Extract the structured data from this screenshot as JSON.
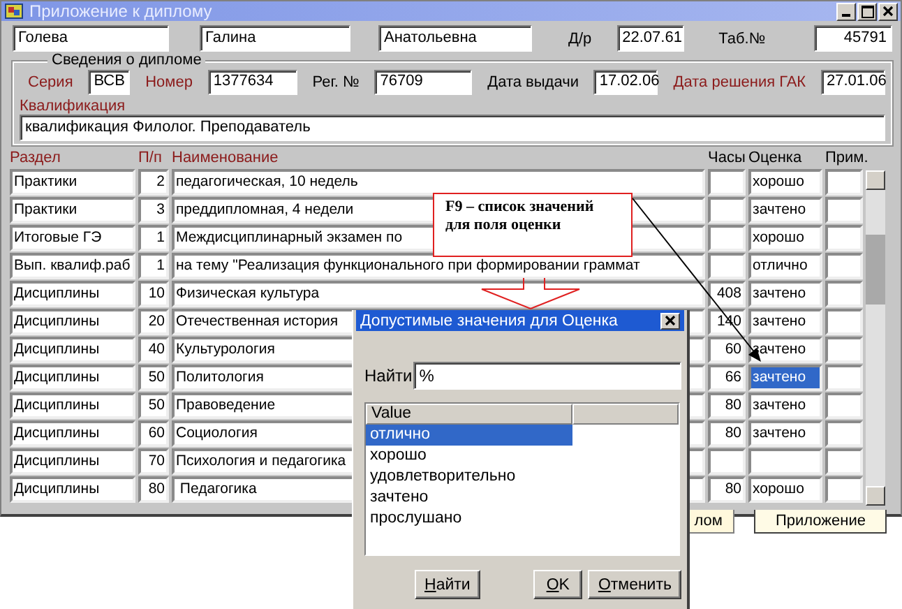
{
  "window": {
    "title": "Приложение к диплому"
  },
  "person": {
    "last_name": "Голева",
    "first_name": "Галина",
    "patronymic": "Анатольевна",
    "birth_label": "Д/р",
    "birth_date": "22.07.61",
    "tab_label": "Таб.№",
    "tab_number": "45791"
  },
  "diploma": {
    "title": "Сведения о дипломе",
    "fields": [
      {
        "label": "Серия",
        "value": "ВСВ",
        "required": true
      },
      {
        "label": "Номер",
        "value": "1377634",
        "required": true
      },
      {
        "label": "Рег. №",
        "value": "76709",
        "required": false
      },
      {
        "label": "Дата выдачи",
        "value": "17.02.06",
        "required": false
      },
      {
        "label": "Дата решения ГАК",
        "value": "27.01.06",
        "required": true
      }
    ],
    "qualification_label": "Квалификация",
    "qualification": "квалификация Филолог. Преподаватель"
  },
  "grid": {
    "columns": [
      {
        "label": "Раздел",
        "required": true
      },
      {
        "label": "П/п",
        "required": true
      },
      {
        "label": "Наименование",
        "required": true
      },
      {
        "label": "Часы",
        "required": false
      },
      {
        "label": "Оценка",
        "required": false
      },
      {
        "label": "Прим.",
        "required": false
      }
    ],
    "rows": [
      {
        "section": "Практики",
        "no": "2",
        "name": "педагогическая, 10 недель",
        "grade": "хорошо",
        "selected": false
      },
      {
        "section": "Практики",
        "no": "3",
        "name": "преддипломная, 4 недели",
        "grade": "зачтено",
        "selected": false
      },
      {
        "section": "Итоговые ГЭ",
        "no": "1",
        "name": "Междисциплинарный экзамен по",
        "grade": "хорошо",
        "selected": false
      },
      {
        "section": "Вып. квалиф.раб",
        "no": "1",
        "name": "на тему \"Реализация функционального при формировании граммат",
        "grade": "отлично",
        "selected": false
      },
      {
        "section": "Дисциплины",
        "no": "10",
        "name": "Физическая культура",
        "hours": "408",
        "grade": "зачтено",
        "selected": false
      },
      {
        "section": "Дисциплины",
        "no": "20",
        "name": "Отечественная история",
        "hours": "140",
        "grade": "зачтено",
        "selected": false
      },
      {
        "section": "Дисциплины",
        "no": "40",
        "name": "Культурология",
        "hours": "60",
        "grade": "зачтено",
        "selected": false
      },
      {
        "section": "Дисциплины",
        "no": "50",
        "name": "Политология",
        "hours": "66",
        "grade": "зачтено",
        "selected": true
      },
      {
        "section": "Дисциплины",
        "no": "50",
        "name": "Правоведение",
        "hours": "80",
        "grade": "зачтено",
        "selected": false
      },
      {
        "section": "Дисциплины",
        "no": "60",
        "name": "Социология",
        "hours": "80",
        "grade": "зачтено",
        "selected": false
      },
      {
        "section": "Дисциплины",
        "no": "70",
        "name": "Психология и педагогика",
        "selected": false
      },
      {
        "section": "Дисциплины",
        "no": "80",
        "name": " Педагогика",
        "hours": "80",
        "grade": "хорошо",
        "selected": false
      }
    ]
  },
  "tabs": [
    {
      "label": "лом",
      "selected": false
    },
    {
      "label": "Приложение",
      "selected": true
    }
  ],
  "callout": {
    "text": "F9 – список значений для поля оценки"
  },
  "dialog": {
    "title": "Допустимые значения для Оценка",
    "search_label": "Найти",
    "search_value": "%",
    "list_header": "Value",
    "items": [
      {
        "label": "отлично",
        "selected": true
      },
      {
        "label": "хорошо",
        "selected": false
      },
      {
        "label": "удовлетворительно",
        "selected": false
      },
      {
        "label": "зачтено",
        "selected": false
      },
      {
        "label": "прослушано",
        "selected": false
      }
    ],
    "buttons": [
      "Найти",
      "OK",
      "Отменить"
    ]
  }
}
